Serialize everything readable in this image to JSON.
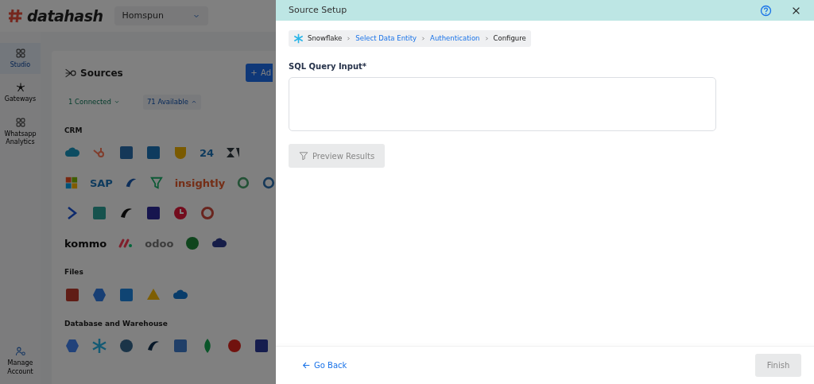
{
  "app": {
    "logo": "datahash",
    "workspace": {
      "value": "Homspun"
    },
    "sidebar": {
      "items": [
        {
          "label": "Studio",
          "selected": true
        },
        {
          "label": "Gateways",
          "selected": false
        },
        {
          "label": "Whatsapp Analytics",
          "selected": false
        }
      ],
      "footer": {
        "label": "Manage Account"
      }
    },
    "page": {
      "title": "Sources",
      "add_button": "Ad",
      "filters": [
        {
          "label": "1 Connected",
          "expanded": false,
          "selected": false
        },
        {
          "label": "71 Available",
          "expanded": true,
          "selected": true
        }
      ],
      "sections": [
        {
          "title": "CRM",
          "rows": [
            [
              {
                "kind": "logo"
              },
              {
                "kind": "logo"
              },
              {
                "kind": "logo"
              },
              {
                "kind": "logo"
              },
              {
                "kind": "logo"
              },
              {
                "kind": "wordmark",
                "text": "24"
              },
              {
                "kind": "logo"
              }
            ],
            [
              {
                "kind": "logo"
              },
              {
                "kind": "wordmark",
                "text": "SAP"
              },
              {
                "kind": "logo"
              },
              {
                "kind": "logo"
              },
              {
                "kind": "wordmark",
                "text": "insightly"
              },
              {
                "kind": "logo"
              },
              {
                "kind": "logo"
              }
            ],
            [
              {
                "kind": "logo"
              },
              {
                "kind": "logo"
              },
              {
                "kind": "logo"
              },
              {
                "kind": "logo"
              },
              {
                "kind": "logo"
              },
              {
                "kind": "logo"
              }
            ],
            [
              {
                "kind": "wordmark",
                "text": "kommo"
              },
              {
                "kind": "logo"
              },
              {
                "kind": "wordmark",
                "text": "odoo"
              },
              {
                "kind": "logo"
              },
              {
                "kind": "logo"
              }
            ]
          ]
        },
        {
          "title": "Files",
          "rows": [
            [
              {
                "kind": "logo"
              },
              {
                "kind": "logo"
              },
              {
                "kind": "logo"
              },
              {
                "kind": "logo"
              },
              {
                "kind": "logo"
              }
            ]
          ]
        },
        {
          "title": "Database and Warehouse",
          "rows": [
            [
              {
                "kind": "logo"
              },
              {
                "kind": "logo"
              },
              {
                "kind": "logo"
              },
              {
                "kind": "logo"
              },
              {
                "kind": "logo"
              },
              {
                "kind": "logo"
              },
              {
                "kind": "logo"
              },
              {
                "kind": "logo"
              }
            ]
          ]
        }
      ]
    }
  },
  "drawer": {
    "title": "Source Setup",
    "breadcrumb": [
      {
        "label": "Snowflake",
        "link": false
      },
      {
        "label": "Select Data Entity",
        "link": true
      },
      {
        "label": "Authentication",
        "link": true
      },
      {
        "label": "Configure",
        "link": false
      }
    ],
    "field": {
      "label": "SQL Query Input*"
    },
    "preview_button": {
      "label": "Preview Results",
      "disabled": true
    },
    "back_link": "Go Back",
    "finish_button": {
      "label": "Finish",
      "disabled": true
    }
  }
}
